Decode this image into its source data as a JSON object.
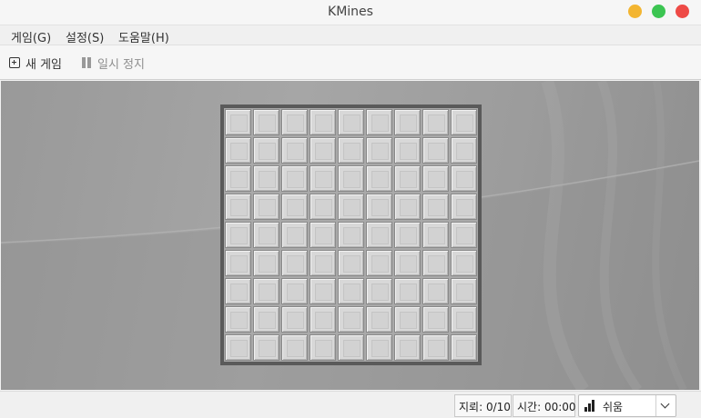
{
  "window": {
    "title": "KMines"
  },
  "menu": {
    "items": [
      "게임(G)",
      "설정(S)",
      "도움말(H)"
    ]
  },
  "toolbar": {
    "new_game": "새 게임",
    "pause": "일시 정지",
    "pause_enabled": false
  },
  "board": {
    "rows": 9,
    "cols": 9,
    "cell_state": "covered"
  },
  "status": {
    "mines": "지뢰: 0/10",
    "time": "시간: 00:00",
    "difficulty": "쉬움"
  },
  "colors": {
    "close": "#ee4a46",
    "minimize": "#f3b531",
    "maximize": "#3cc552",
    "board_border": "#5a5a5a"
  },
  "icons": {
    "new_game": "plus-square-icon",
    "pause": "pause-icon",
    "difficulty": "bar-chart-icon",
    "dropdown": "chevron-down-icon"
  }
}
